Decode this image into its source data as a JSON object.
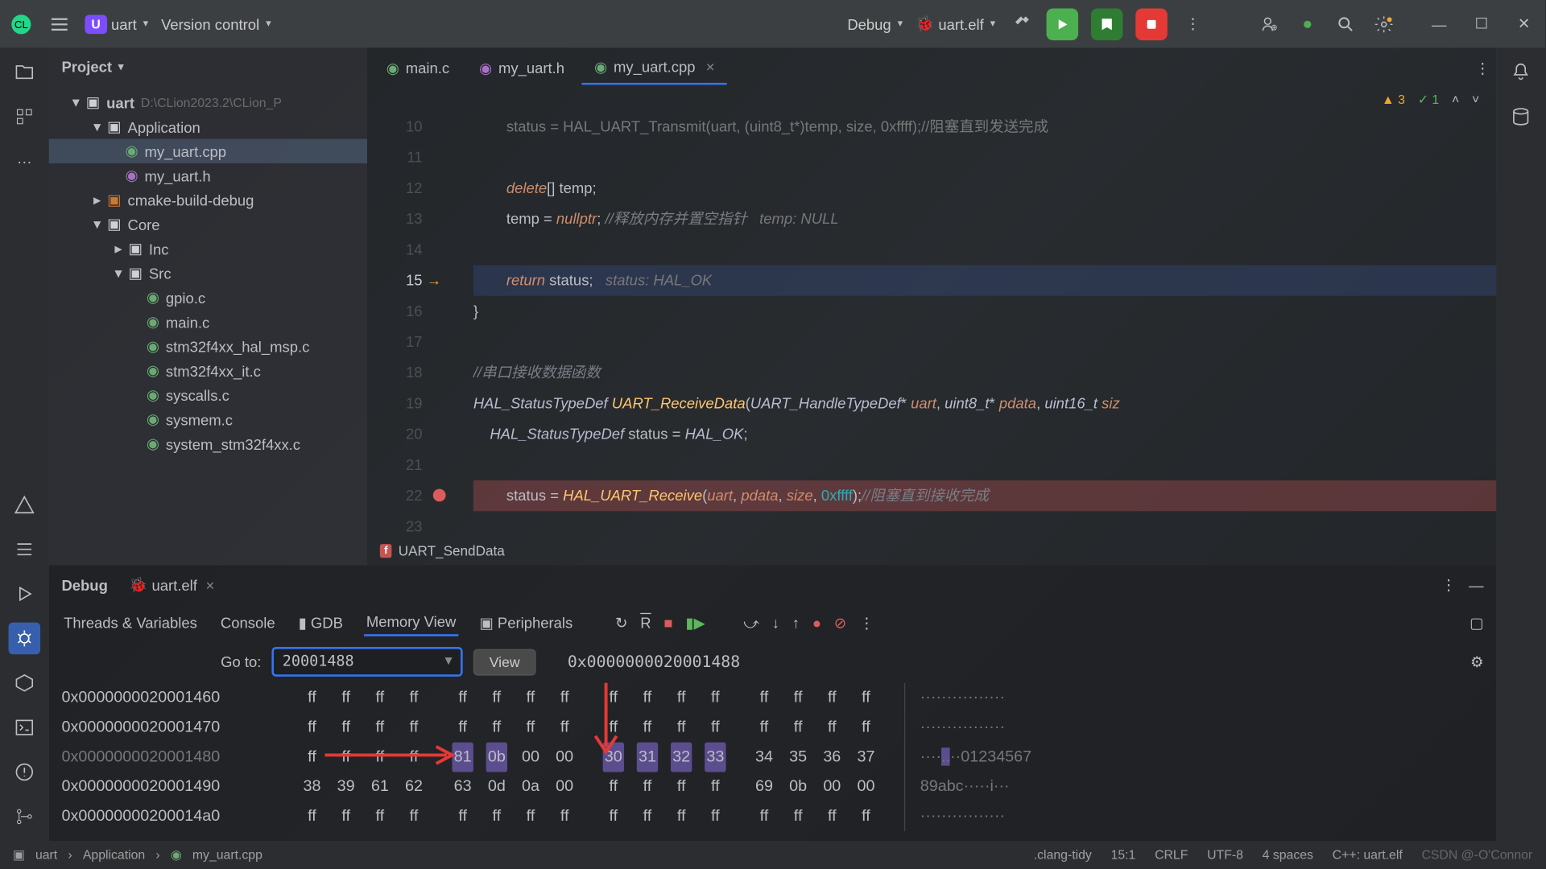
{
  "titlebar": {
    "project_badge": "U",
    "project_name": "uart",
    "vcs": "Version control",
    "config": "Debug",
    "target": "uart.elf"
  },
  "project_panel": {
    "title": "Project",
    "tree": {
      "root_name": "uart",
      "root_path": "D:\\CLion2023.2\\CLion_P",
      "app_folder": "Application",
      "cmake_folder": "cmake-build-debug",
      "core_folder": "Core",
      "inc_folder": "Inc",
      "src_folder": "Src",
      "files": {
        "my_uart_cpp": "my_uart.cpp",
        "my_uart_h": "my_uart.h",
        "gpio_c": "gpio.c",
        "main_c": "main.c",
        "hal_msp": "stm32f4xx_hal_msp.c",
        "it_c": "stm32f4xx_it.c",
        "syscalls": "syscalls.c",
        "sysmem": "sysmem.c",
        "system": "system_stm32f4xx.c"
      }
    }
  },
  "editor": {
    "tabs": [
      {
        "label": "main.c"
      },
      {
        "label": "my_uart.h"
      },
      {
        "label": "my_uart.cpp"
      }
    ],
    "warnings": "3",
    "hints": "1",
    "lines": {
      "10": {
        "num": "10",
        "code": "        status = HAL_UART_Transmit(uart, (uint8_t*)temp, size, 0xffff);//阻塞直到发送完成"
      },
      "11": {
        "num": "11"
      },
      "12": {
        "num": "12",
        "delete": "delete",
        "after": "[] temp;"
      },
      "13": {
        "num": "13",
        "pre": "        temp ",
        "op": "=",
        "nullptr": " nullptr",
        "semi": "; ",
        "cmt": "//释放内存并置空指针",
        "hint": "   temp: NULL"
      },
      "14": {
        "num": "14"
      },
      "15": {
        "num": "15",
        "return": "return",
        "status": " status;",
        "hint": "   status: HAL_OK"
      },
      "16": {
        "num": "16",
        "brace": "}"
      },
      "17": {
        "num": "17"
      },
      "18": {
        "num": "18",
        "cmt": "//串口接收数据函数"
      },
      "19": {
        "num": "19",
        "type1": "HAL_StatusTypeDef ",
        "fn": "UART_ReceiveData",
        "open": "(",
        "type2": "UART_HandleTypeDef",
        "star": "* ",
        "p1": "uart",
        "c1": ", ",
        "type3": "uint8_t",
        "star2": "* ",
        "p2": "pdata",
        "c2": ", ",
        "type4": "uint16_t ",
        "p3": "siz"
      },
      "20": {
        "num": "20",
        "type": "    HAL_StatusTypeDef ",
        "var": "status ",
        "op": "= ",
        "val": "HAL_OK",
        "semi": ";"
      },
      "21": {
        "num": "21"
      },
      "22": {
        "num": "22",
        "pre": "        status ",
        "op": "= ",
        "fn": "HAL_UART_Receive",
        "open": "(",
        "p1": "uart",
        "c1": ", ",
        "p2": "pdata",
        "c2": ", ",
        "p3": "size",
        "c3": ", ",
        "lit": "0xffff",
        "close": ");",
        "cmt": "//阻塞直到接收完成"
      },
      "23": {
        "num": "23"
      }
    },
    "crumb": "UART_SendData"
  },
  "debug": {
    "title": "Debug",
    "target_chip": "uart.elf",
    "tabs": {
      "threads": "Threads & Variables",
      "console": "Console",
      "gdb": "GDB",
      "memory": "Memory View",
      "peripherals": "Peripherals"
    },
    "goto_label": "Go to:",
    "goto_value": "20001488",
    "view_btn": "View",
    "current_addr": "0x0000000020001488",
    "rows": [
      {
        "addr": "0x0000000020001460",
        "g1": [
          "ff",
          "ff",
          "ff",
          "ff"
        ],
        "g2": [
          "ff",
          "ff",
          "ff",
          "ff"
        ],
        "g3": [
          "ff",
          "ff",
          "ff",
          "ff"
        ],
        "g4": [
          "ff",
          "ff",
          "ff",
          "ff"
        ],
        "ascii": "················"
      },
      {
        "addr": "0x0000000020001470",
        "g1": [
          "ff",
          "ff",
          "ff",
          "ff"
        ],
        "g2": [
          "ff",
          "ff",
          "ff",
          "ff"
        ],
        "g3": [
          "ff",
          "ff",
          "ff",
          "ff"
        ],
        "g4": [
          "ff",
          "ff",
          "ff",
          "ff"
        ],
        "ascii": "················"
      },
      {
        "addr": "0x0000000020001480",
        "g1": [
          "ff",
          "ff",
          "ff",
          "ff"
        ],
        "g2": [
          "81",
          "0b",
          "00",
          "00"
        ],
        "g3": [
          "30",
          "31",
          "32",
          "33"
        ],
        "g4": [
          "34",
          "35",
          "36",
          "37"
        ],
        "ascii": "····..··01234567",
        "sel": true
      },
      {
        "addr": "0x0000000020001490",
        "g1": [
          "38",
          "39",
          "61",
          "62"
        ],
        "g2": [
          "63",
          "0d",
          "0a",
          "00"
        ],
        "g3": [
          "ff",
          "ff",
          "ff",
          "ff"
        ],
        "g4": [
          "69",
          "0b",
          "00",
          "00"
        ],
        "ascii": "89abc·····i···"
      },
      {
        "addr": "0x00000000200014a0",
        "g1": [
          "ff",
          "ff",
          "ff",
          "ff"
        ],
        "g2": [
          "ff",
          "ff",
          "ff",
          "ff"
        ],
        "g3": [
          "ff",
          "ff",
          "ff",
          "ff"
        ],
        "g4": [
          "ff",
          "ff",
          "ff",
          "ff"
        ],
        "ascii": "················"
      }
    ]
  },
  "statusbar": {
    "b1": "uart",
    "b2": "Application",
    "b3": "my_uart.cpp",
    "clang": ".clang-tidy",
    "pos": "15:1",
    "eol": "CRLF",
    "enc": "UTF-8",
    "indent": "4 spaces",
    "toolchain": "C++: uart.elf",
    "watermark": "CSDN @-O'Connor"
  }
}
